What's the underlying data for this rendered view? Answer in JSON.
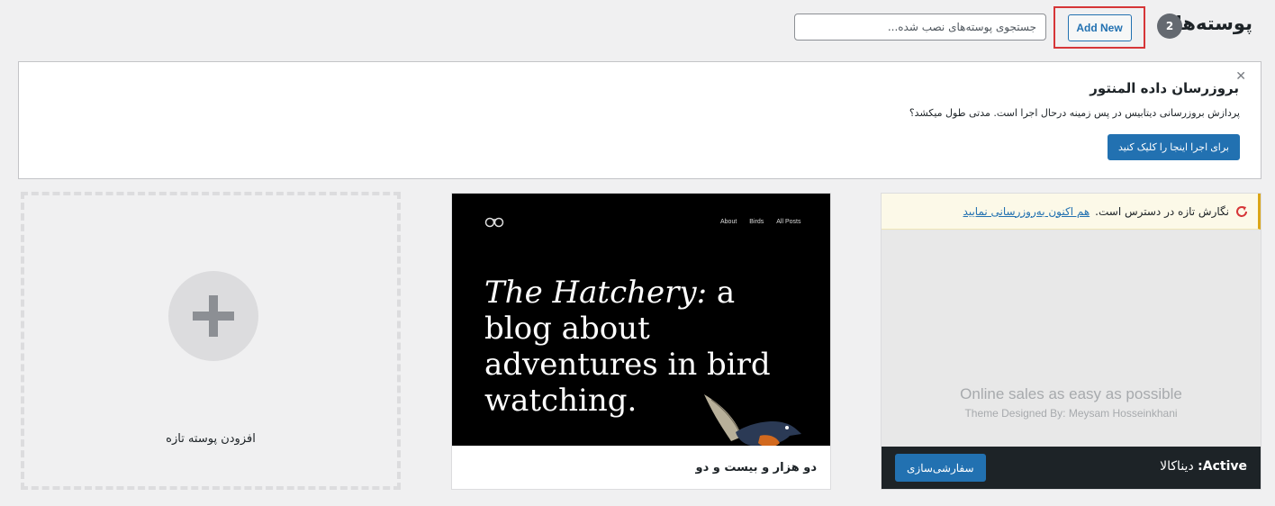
{
  "header": {
    "title": "پوسته‌ها",
    "count": "2",
    "add_new_label": "Add New",
    "search_placeholder": "جستجوی پوسته‌های نصب شده..."
  },
  "notice": {
    "title": "بروزرسان داده المنتور",
    "text": "پردازش بروزرسانی دیتابیس در پس زمینه درحال اجرا است. مدتی طول میکشد؟",
    "button_label": "برای اجرا اینجا را کلیک کنید",
    "close_glyph": "✕"
  },
  "add_theme": {
    "label": "افزودن پوسته تازه"
  },
  "themes": [
    {
      "name": "دو هزار و بیست و دو",
      "screenshot": {
        "nav": [
          "About",
          "Birds",
          "All Posts"
        ],
        "headline_italic": "The Hatchery:",
        "headline_rest": " a blog about adventures in bird watching."
      }
    }
  ],
  "active_theme": {
    "update_text": "نگارش تازه در دسترس است.",
    "update_link": "هم اکنون به‌روزرسانی نمایید",
    "screenshot_heading": "Online sales as easy as possible",
    "screenshot_sub": "Theme Designed By: Meysam Hosseinkhani",
    "active_label": "Active:",
    "name": "دیناکالا",
    "customize_label": "سفارشی‌سازی"
  },
  "colors": {
    "accent": "#2271b1",
    "highlight_border": "#d63638",
    "warning": "#dba617",
    "dark_bar": "#1d2327"
  }
}
